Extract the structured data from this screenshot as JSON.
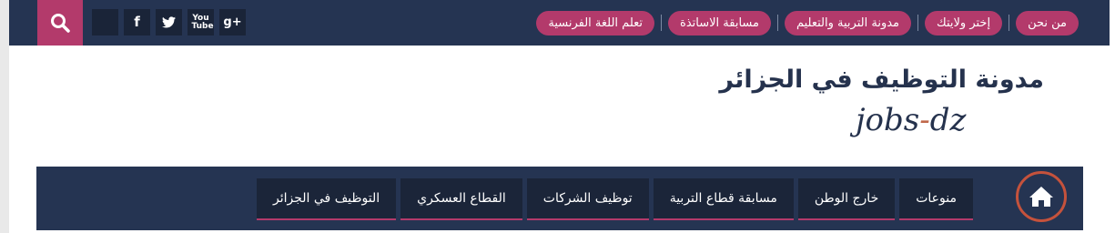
{
  "topbar": {
    "links": [
      {
        "label": "من نحن"
      },
      {
        "label": "إختر ولايتك"
      },
      {
        "label": "مدونة التربية والتعليم"
      },
      {
        "label": "مسابقة الاساتذة"
      },
      {
        "label": "تعلم اللغة الفرنسية"
      }
    ],
    "social": [
      {
        "icon": "blank-social-icon"
      },
      {
        "icon": "facebook-icon",
        "glyph": "f"
      },
      {
        "icon": "twitter-icon",
        "glyph": "🐦"
      },
      {
        "icon": "youtube-icon",
        "glyph": "You Tube"
      },
      {
        "icon": "google-plus-icon",
        "glyph": "g+"
      }
    ],
    "search_icon": "search-icon"
  },
  "logo": {
    "title": "مدونة التوظيف في الجزائر",
    "subtitle_prefix": "jobs",
    "subtitle_dash": "-",
    "subtitle_suffix": "dz"
  },
  "nav": {
    "home_icon": "home-icon",
    "items": [
      {
        "label": "منوعات"
      },
      {
        "label": "خارج الوطن"
      },
      {
        "label": "مسابقة قطاع التربية"
      },
      {
        "label": "توظيف الشركات"
      },
      {
        "label": "القطاع العسكري"
      },
      {
        "label": "التوظيف في الجزائر"
      }
    ]
  },
  "colors": {
    "navy": "#253452",
    "accent": "#b33a6b",
    "home_ring": "#c5523c"
  }
}
